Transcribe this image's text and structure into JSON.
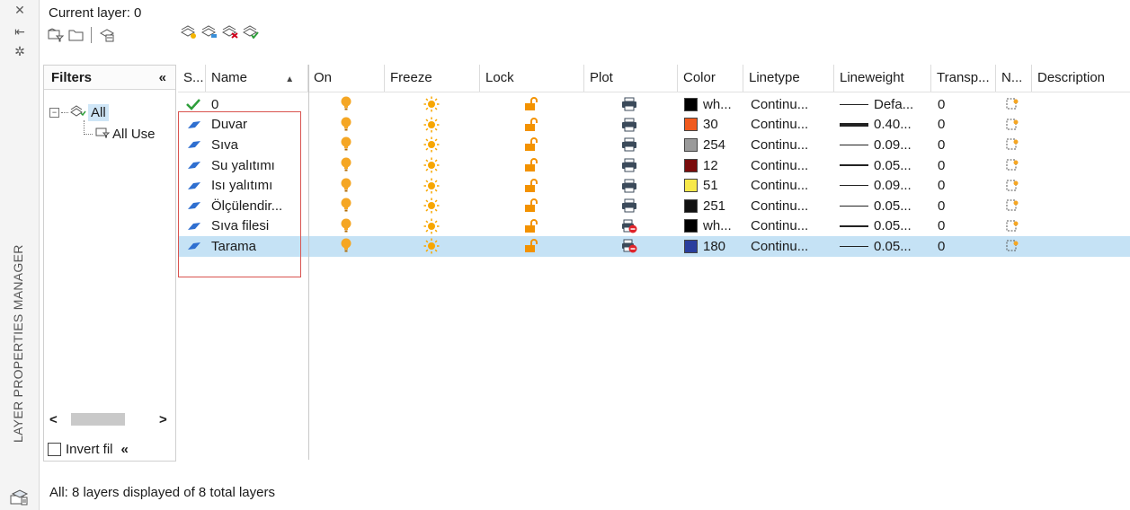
{
  "palette": {
    "title": "LAYER PROPERTIES MANAGER",
    "current_layer_label": "Current layer: 0",
    "status": "All: 8 layers displayed of 8 total layers"
  },
  "toolbar": {
    "left_icons": [
      "new-property-filter-icon",
      "new-group-filter-icon",
      "layer-states-manager-icon"
    ],
    "right_icons": [
      "new-layer-icon",
      "new-layer-vp-frozen-icon",
      "delete-layer-icon",
      "set-current-icon"
    ]
  },
  "filters": {
    "header": "Filters",
    "collapse_glyph": "«",
    "tree": [
      {
        "label": "All",
        "selected": true
      },
      {
        "label": "All Use",
        "selected": false
      }
    ],
    "invert_label": "Invert fil",
    "invert_checked": false,
    "scroll_left": "<",
    "scroll_right": ">"
  },
  "columns": {
    "status": "S...",
    "name": "Name",
    "sort_glyph": "▲",
    "on": "On",
    "freeze": "Freeze",
    "lock": "Lock",
    "plot": "Plot",
    "color": "Color",
    "linetype": "Linetype",
    "lineweight": "Lineweight",
    "transparency": "Transp...",
    "new_vp_freeze": "N...",
    "description": "Description"
  },
  "layers": [
    {
      "status": "current",
      "name": "0",
      "plot": true,
      "color_hex": "#000000",
      "color_name": "wh...",
      "linetype": "Continu...",
      "lineweight": "Defa...",
      "lw_thick": false,
      "transparency": "0",
      "selected": false
    },
    {
      "status": "layer",
      "name": "Duvar",
      "plot": true,
      "color_hex": "#f05a1e",
      "color_name": "30",
      "linetype": "Continu...",
      "lineweight": "0.40...",
      "lw_thick": true,
      "transparency": "0",
      "selected": false
    },
    {
      "status": "layer",
      "name": "Sıva",
      "plot": true,
      "color_hex": "#9a9a9a",
      "color_name": "254",
      "linetype": "Continu...",
      "lineweight": "0.09...",
      "lw_thick": false,
      "transparency": "0",
      "selected": false
    },
    {
      "status": "layer",
      "name": "Su yalıtımı",
      "plot": true,
      "color_hex": "#7a0c0c",
      "color_name": "12",
      "linetype": "Continu...",
      "lineweight": "0.05...",
      "lw_thick": false,
      "transparency": "0",
      "selected": false
    },
    {
      "status": "layer",
      "name": "Isı yalıtımı",
      "plot": true,
      "color_hex": "#f7e84a",
      "color_name": "51",
      "linetype": "Continu...",
      "lineweight": "0.09...",
      "lw_thick": false,
      "transparency": "0",
      "selected": false
    },
    {
      "status": "layer",
      "name": "Ölçülendir...",
      "plot": true,
      "color_hex": "#111111",
      "color_name": "251",
      "linetype": "Continu...",
      "lineweight": "0.05...",
      "lw_thick": false,
      "transparency": "0",
      "selected": false
    },
    {
      "status": "layer",
      "name": "Sıva filesi",
      "plot": false,
      "color_hex": "#000000",
      "color_name": "wh...",
      "linetype": "Continu...",
      "lineweight": "0.05...",
      "lw_thick": false,
      "transparency": "0",
      "selected": false
    },
    {
      "status": "layer",
      "name": "Tarama",
      "plot": false,
      "color_hex": "#2b3f9e",
      "color_name": "180",
      "linetype": "Continu...",
      "lineweight": "0.05...",
      "lw_thick": false,
      "transparency": "0",
      "selected": true
    }
  ],
  "colors": {
    "bulb_on": "#f5a623",
    "sun": "#f7a600",
    "lock": "#f39200",
    "selection_row": "#c5e2f5",
    "annotation_box": "#d9534f"
  }
}
